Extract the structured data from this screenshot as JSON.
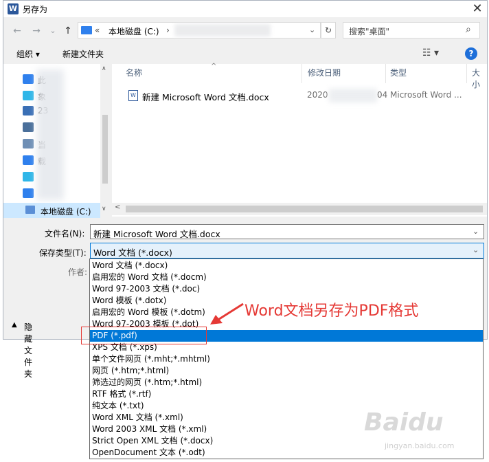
{
  "window": {
    "title": "另存为",
    "app_icon_letter": "W",
    "close_label": "✕"
  },
  "nav": {
    "back": "←",
    "forward": "→",
    "dropdown": "⌄",
    "up": "↑",
    "address_sep": "«",
    "address": "本地磁盘 (C:)",
    "address_arrow": "›",
    "refresh": "↻",
    "search_placeholder": "搜索\"桌面\"",
    "search_icon": "⌕"
  },
  "toolbar": {
    "organize": "组织 ▾",
    "new_folder": "新建文件夹",
    "view_icon": "☷ ▾",
    "help": "?"
  },
  "left_pane": {
    "items": [
      {
        "label": "此",
        "color": "#2f80ed"
      },
      {
        "label": "象",
        "color": "#2fb6e8"
      },
      {
        "label": "23",
        "color": "#3a6fb5"
      },
      {
        "label": "",
        "color": "#4a6f9a"
      },
      {
        "label": "当",
        "color": "#6f8fb5"
      },
      {
        "label": "载",
        "color": "#2f80ed"
      },
      {
        "label": "",
        "color": "#2fb6e8"
      },
      {
        "label": "",
        "color": "#2f80ed"
      }
    ],
    "c_drive": "本地磁盘 (C:)",
    "scroll_up": "∧",
    "scroll_down": "∨"
  },
  "columns": {
    "name": "名称",
    "modified": "修改日期",
    "type": "类型",
    "size": "大小"
  },
  "files": [
    {
      "name": "新建 Microsoft Word 文档.docx",
      "date_prefix": "2020",
      "date_suffix": "04",
      "type": "Microsoft Word ..."
    }
  ],
  "form": {
    "filename_label": "文件名(N):",
    "filename_value": "新建 Microsoft Word 文档.docx",
    "filetype_label": "保存类型(T):",
    "filetype_value": "Word 文档 (*.docx)",
    "author_label": "作者:",
    "dropdown_arrow": "⌄",
    "hide_folders": "隐藏文件夹",
    "hide_arrow": "▲"
  },
  "filetype_options": [
    "Word 文档 (*.docx)",
    "启用宏的 Word 文档 (*.docm)",
    "Word 97-2003 文档 (*.doc)",
    "Word 模板 (*.dotx)",
    "启用宏的 Word 模板 (*.dotm)",
    "Word 97-2003 模板 (*.dot)",
    "PDF (*.pdf)",
    "XPS 文档 (*.xps)",
    "单个文件网页 (*.mht;*.mhtml)",
    "网页 (*.htm;*.html)",
    "筛选过的网页 (*.htm;*.html)",
    "RTF 格式 (*.rtf)",
    "纯文本 (*.txt)",
    "Word XML 文档 (*.xml)",
    "Word 2003 XML 文档 (*.xml)",
    "Strict Open XML 文档 (*.docx)",
    "OpenDocument 文本 (*.odt)"
  ],
  "selected_option_index": 6,
  "annotation": {
    "text": "Word文档另存为PDF格式",
    "color": "#e53935"
  },
  "watermark": {
    "text": "Baidu",
    "sub": "jingyan.baidu.com"
  }
}
